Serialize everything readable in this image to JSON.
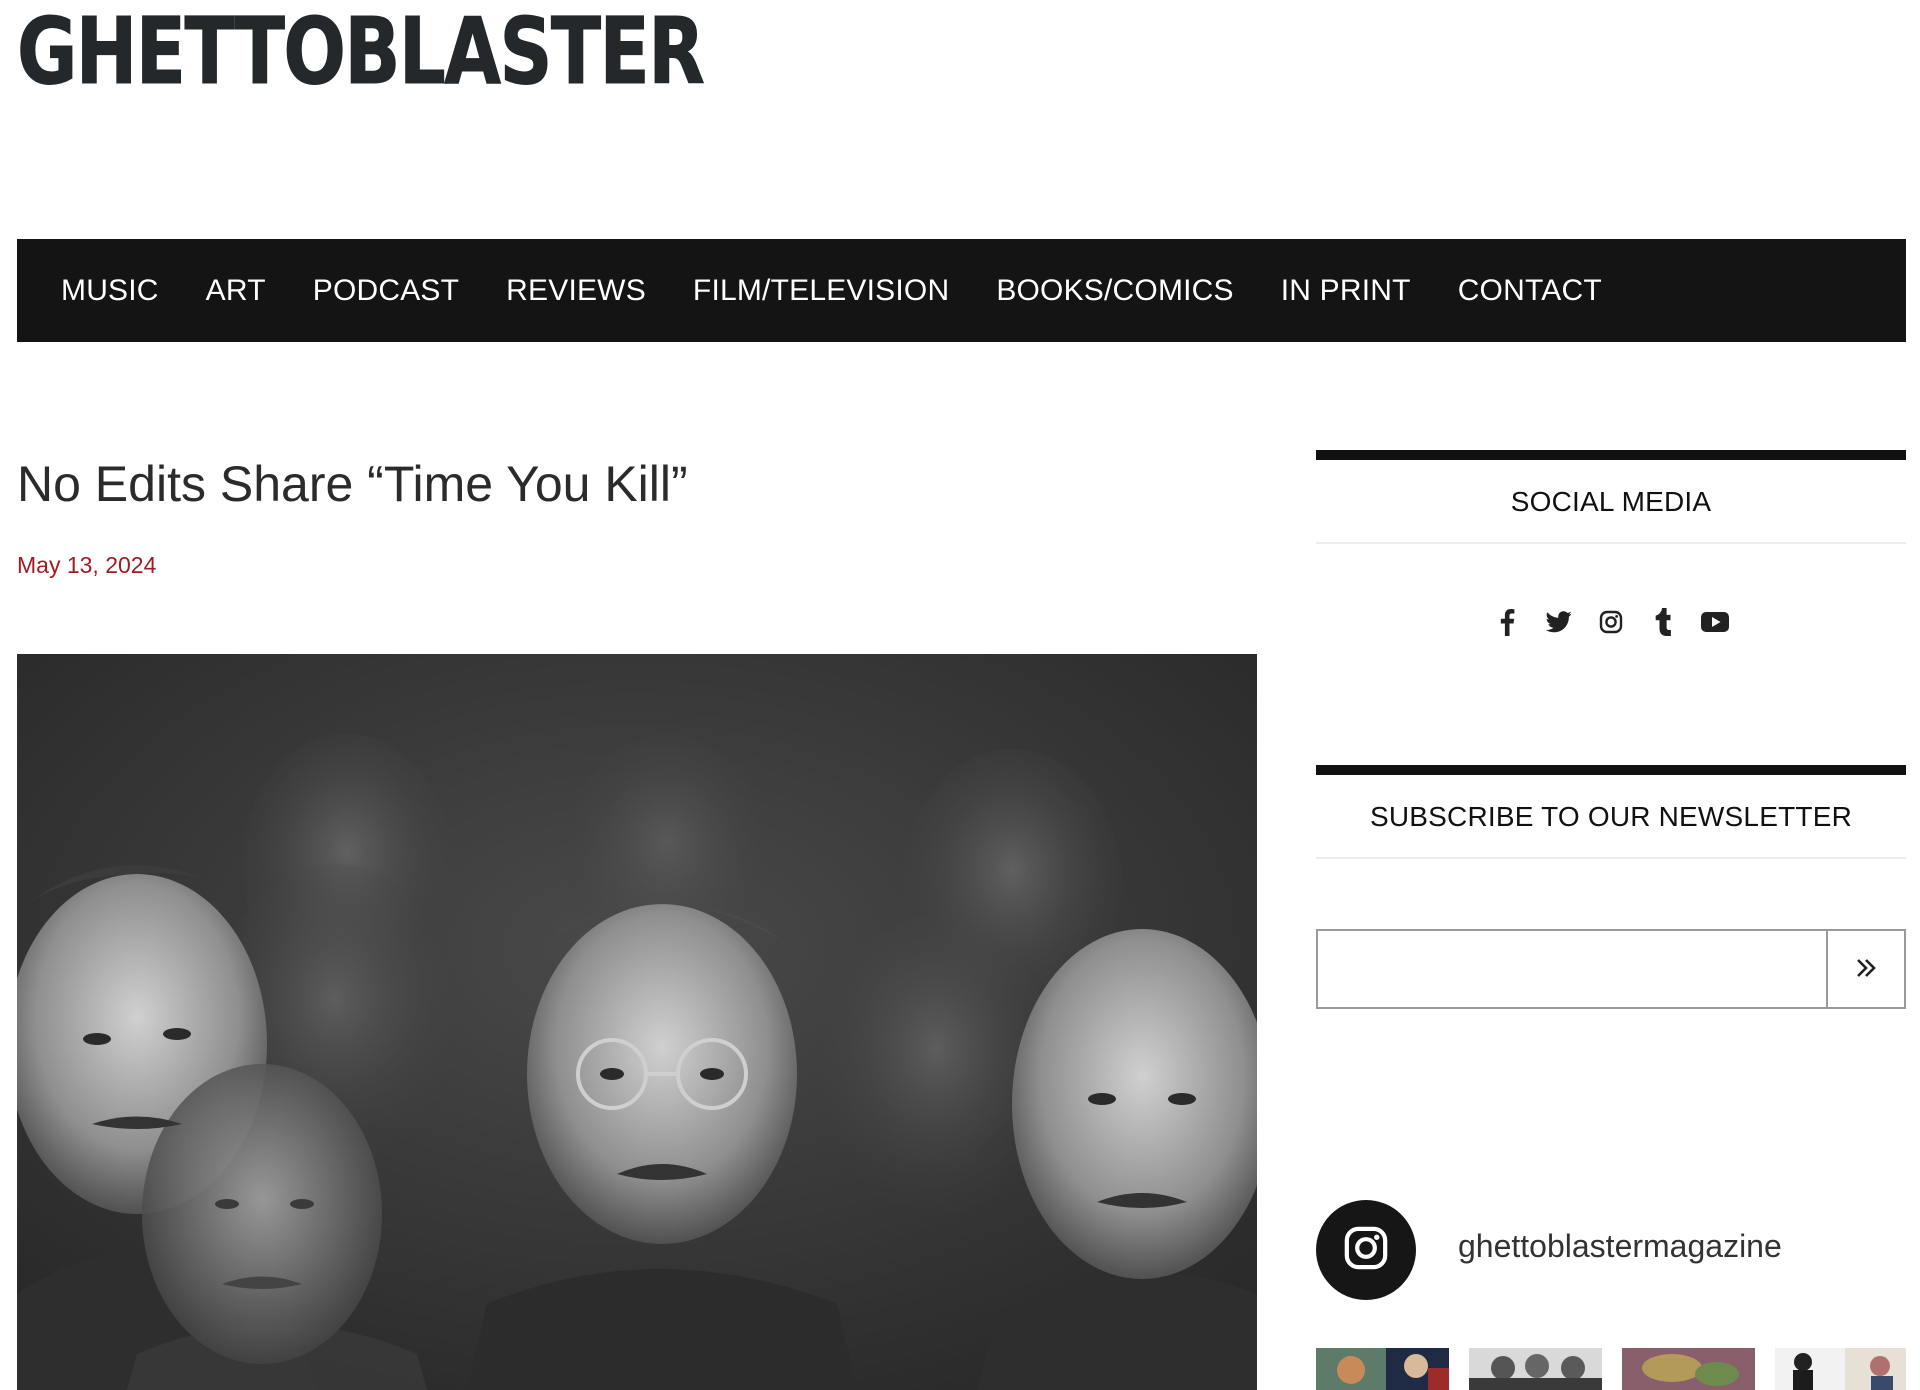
{
  "site": {
    "logo_text": "GHETTOBLASTER"
  },
  "nav": {
    "items": [
      {
        "label": "MUSIC"
      },
      {
        "label": "ART"
      },
      {
        "label": "PODCAST"
      },
      {
        "label": "REVIEWS"
      },
      {
        "label": "FILM/TELEVISION"
      },
      {
        "label": "BOOKS/COMICS"
      },
      {
        "label": "IN PRINT"
      },
      {
        "label": "CONTACT"
      }
    ]
  },
  "post": {
    "title": "No Edits Share “Time You Kill”",
    "date": "May 13, 2024"
  },
  "sidebar": {
    "social": {
      "heading": "SOCIAL MEDIA",
      "icons": [
        "facebook-icon",
        "twitter-icon",
        "instagram-icon",
        "tumblr-icon",
        "youtube-icon"
      ]
    },
    "newsletter": {
      "heading": "SUBSCRIBE TO OUR NEWSLETTER",
      "input_value": "",
      "submit_icon": "double-chevron-right-icon"
    },
    "instagram": {
      "handle": "ghettoblastermagazine"
    }
  },
  "colors": {
    "nav_bg": "#141414",
    "date_red": "#a01c23",
    "logo": "#24282b"
  }
}
